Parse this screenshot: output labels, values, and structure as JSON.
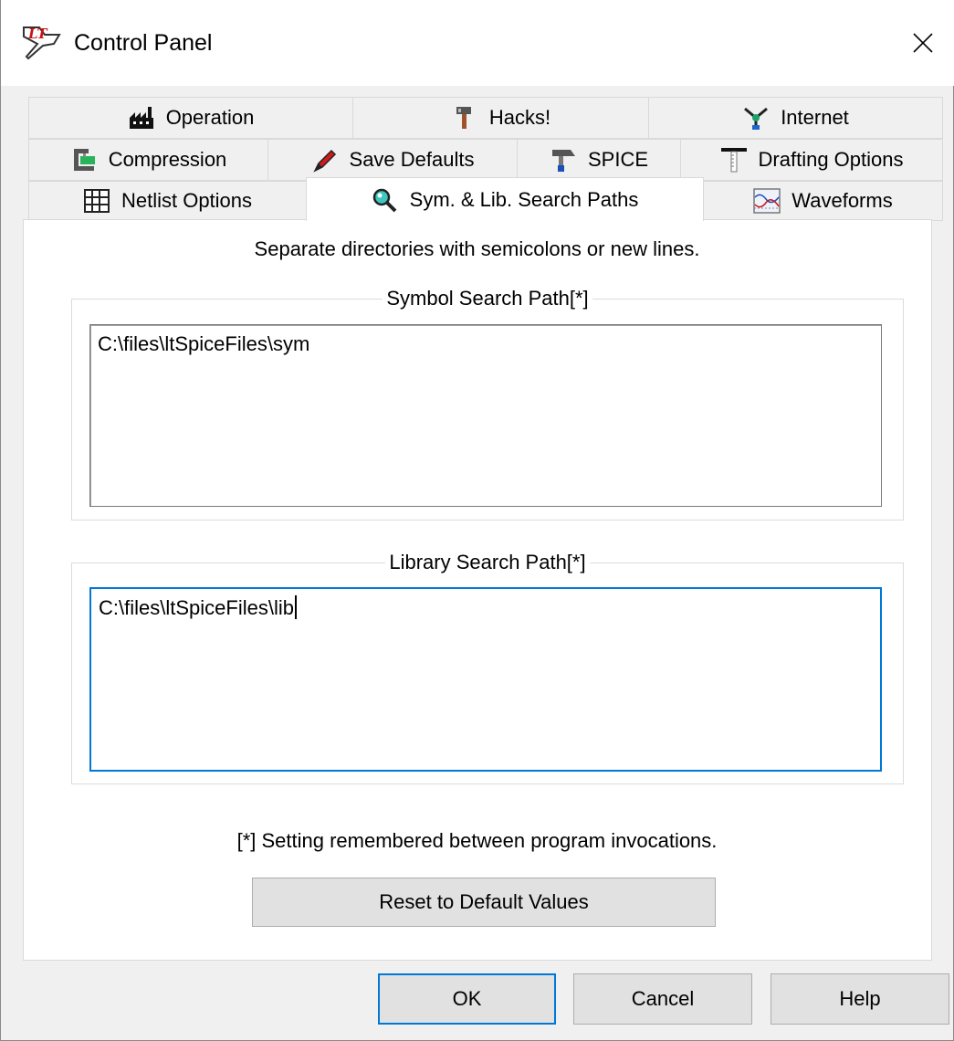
{
  "window": {
    "title": "Control Panel"
  },
  "tabs": {
    "row1": [
      {
        "label": "Operation",
        "icon": "factory-icon"
      },
      {
        "label": "Hacks!",
        "icon": "hammer-icon"
      },
      {
        "label": "Internet",
        "icon": "network-icon"
      }
    ],
    "row2": [
      {
        "label": "Compression",
        "icon": "clamp-icon"
      },
      {
        "label": "Save Defaults",
        "icon": "pen-icon"
      },
      {
        "label": "SPICE",
        "icon": "spice-hammer-icon"
      },
      {
        "label": "Drafting Options",
        "icon": "ruler-icon"
      }
    ],
    "row3": [
      {
        "label": "Netlist Options",
        "icon": "grid-icon"
      },
      {
        "label": "Sym. & Lib. Search Paths",
        "icon": "magnifier-icon"
      },
      {
        "label": "Waveforms",
        "icon": "waveform-icon"
      }
    ],
    "active": "Sym. & Lib. Search Paths"
  },
  "panel": {
    "hint": "Separate directories with semicolons or new lines.",
    "symbol_group_label": "Symbol Search Path[*]",
    "symbol_path_value": "C:\\files\\ltSpiceFiles\\sym",
    "library_group_label": "Library Search Path[*]",
    "library_path_value": "C:\\files\\ltSpiceFiles\\lib",
    "note": "[*] Setting remembered between program invocations.",
    "reset_label": "Reset to Default Values"
  },
  "buttons": {
    "ok": "OK",
    "cancel": "Cancel",
    "help": "Help"
  },
  "colors": {
    "focus_blue": "#0078d7",
    "dialog_bg": "#f0f0f0"
  }
}
